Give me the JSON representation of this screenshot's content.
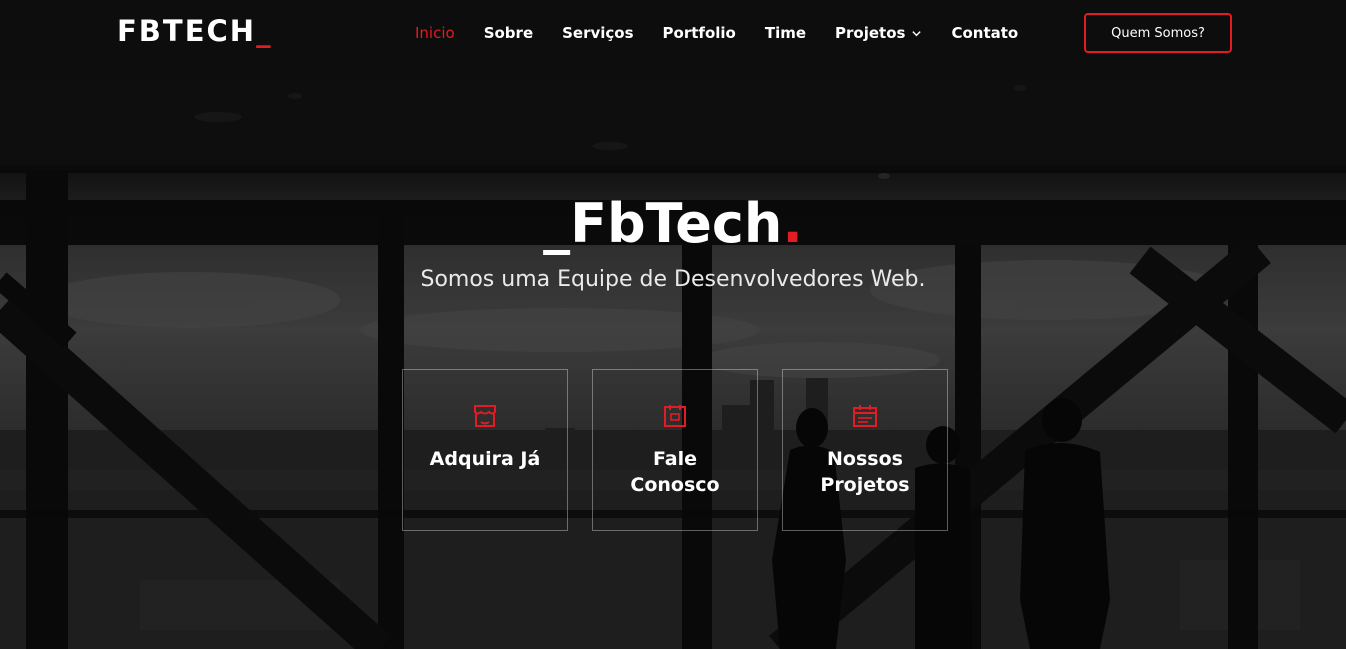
{
  "brand": {
    "logo_text": "FBTECH",
    "logo_cursor": "_"
  },
  "colors": {
    "accent": "#e31b23",
    "text": "#ffffff",
    "background": "#111111"
  },
  "nav": {
    "items": [
      {
        "label": "Inicio",
        "active": true
      },
      {
        "label": "Sobre"
      },
      {
        "label": "Serviços"
      },
      {
        "label": "Portfolio"
      },
      {
        "label": "Time"
      },
      {
        "label": "Projetos",
        "icon": "chevron-down-icon"
      },
      {
        "label": "Contato"
      }
    ]
  },
  "cta": {
    "label": "Quem Somos?"
  },
  "hero": {
    "title_prefix": "_",
    "title": "FbTech",
    "title_dot": ".",
    "subtitle": "Somos uma Equipe de Desenvolvedores Web."
  },
  "cards": [
    {
      "label": "Adquira Já",
      "icon": "store-icon"
    },
    {
      "label": "Fale\nConosco",
      "icon": "calendar-chat-icon"
    },
    {
      "label": "Nossos\nProjetos",
      "icon": "calendar-icon"
    }
  ]
}
